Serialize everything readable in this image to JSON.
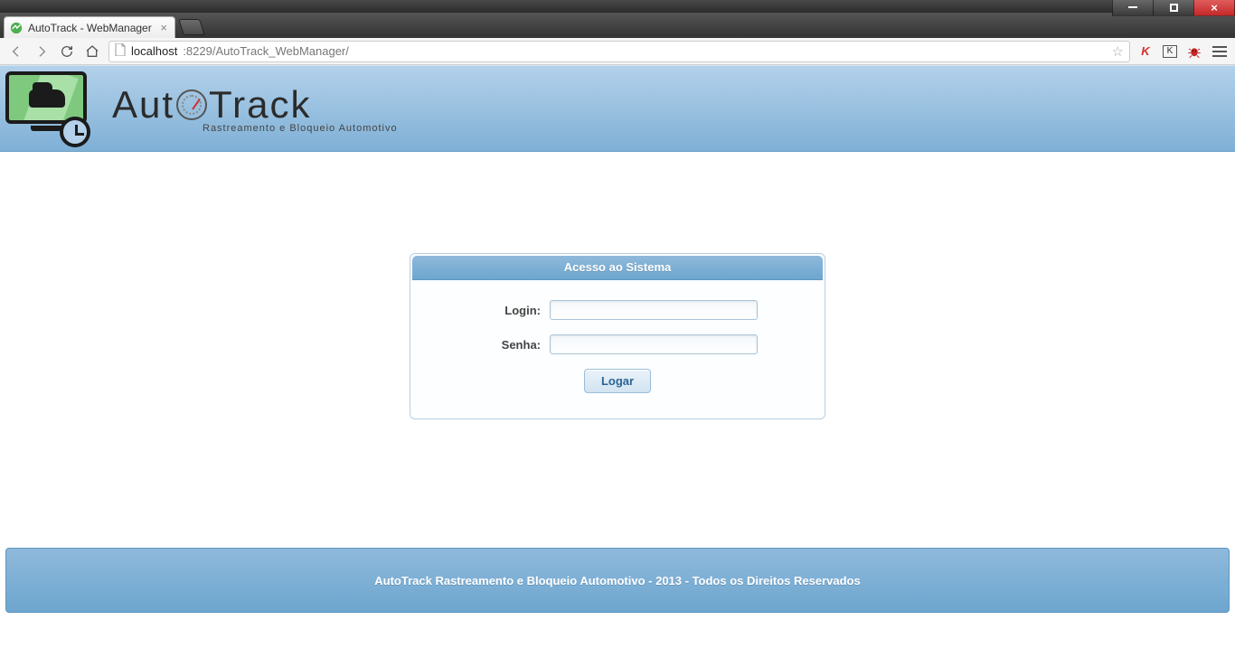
{
  "browser": {
    "tab_title": "AutoTrack - WebManager",
    "url_host": "localhost",
    "url_port_path": ":8229/AutoTrack_WebManager/"
  },
  "header": {
    "brand_part1": "Aut",
    "brand_part2": "Track",
    "tagline": "Rastreamento e Bloqueio Automotivo"
  },
  "login": {
    "panel_title": "Acesso ao Sistema",
    "login_label": "Login:",
    "senha_label": "Senha:",
    "login_value": "",
    "senha_value": "",
    "button_label": "Logar"
  },
  "footer": {
    "text": "AutoTrack Rastreamento e Bloqueio Automotivo - 2013 - Todos os Direitos Reservados"
  }
}
